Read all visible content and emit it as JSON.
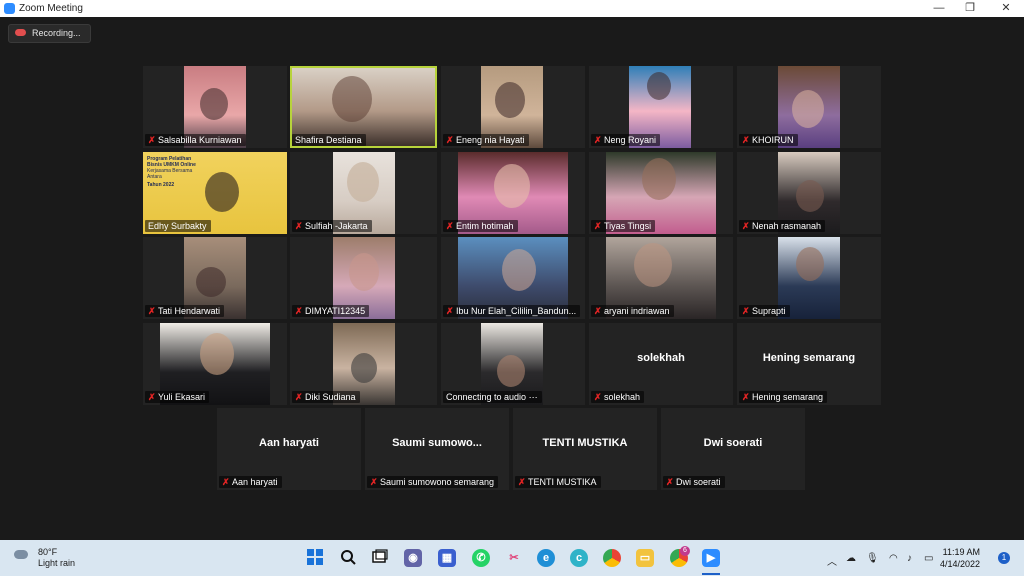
{
  "window": {
    "title": "Zoom Meeting",
    "minimize": "—",
    "maximize": "❐",
    "close": "✕"
  },
  "recording": {
    "label": "Recording..."
  },
  "participants": [
    {
      "name": "Salsabilla Kurniawan",
      "muted": true
    },
    {
      "name": "Shafira Destiana",
      "muted": false,
      "active": true
    },
    {
      "name": "Eneng nia Hayati",
      "muted": true
    },
    {
      "name": "Neng Royani",
      "muted": true
    },
    {
      "name": "KHOIRUN",
      "muted": true
    },
    {
      "name": "Edhy Surbakty",
      "muted": false,
      "slide": {
        "title": "Program Pelatihan Bisnis UMKM Online",
        "subtitle": "Kerjasama Bersama Antara",
        "year": "Tahun 2022"
      }
    },
    {
      "name": "Sulfiah -Jakarta",
      "muted": true
    },
    {
      "name": "Entim hotimah",
      "muted": true
    },
    {
      "name": "Tiyas Tingsi",
      "muted": true
    },
    {
      "name": "Nenah rasmanah",
      "muted": true
    },
    {
      "name": "Tati Hendarwati",
      "muted": true
    },
    {
      "name": "DIMYATI12345",
      "muted": true
    },
    {
      "name": "Ibu Nur Elah_Cililin_Bandun...",
      "muted": true
    },
    {
      "name": "aryani indriawan",
      "muted": true
    },
    {
      "name": "Suprapti",
      "muted": true
    },
    {
      "name": "Yuli Ekasari",
      "muted": true
    },
    {
      "name": "Diki Sudiana",
      "muted": true
    },
    {
      "name": "Connecting to audio",
      "muted": false,
      "status_icon": "⋯"
    },
    {
      "name": "solekhah",
      "display": "solekhah",
      "muted": true
    },
    {
      "name": "Hening semarang",
      "display": "Hening semarang",
      "muted": true
    },
    {
      "name": "Aan haryati",
      "display": "Aan haryati",
      "muted": true
    },
    {
      "name": "Saumi sumowono semarang",
      "display": "Saumi  sumowo...",
      "muted": true
    },
    {
      "name": "TENTI MUSTIKA",
      "display": "TENTI MUSTIKA",
      "muted": true
    },
    {
      "name": "Dwi soerati",
      "display": "Dwi soerati",
      "muted": true
    }
  ],
  "taskbar": {
    "weather": {
      "temp": "80°F",
      "desc": "Light rain"
    },
    "apps": [
      "windows-start",
      "search",
      "task-view",
      "teams-chat",
      "microsoft-store",
      "whatsapp",
      "snipping-tool",
      "edge",
      "cortana",
      "chrome",
      "file-explorer",
      "chrome-profile",
      "zoom"
    ],
    "badge": "6",
    "clock": {
      "time": "11:19 AM",
      "date": "4/14/2022"
    },
    "notifications": "1"
  }
}
